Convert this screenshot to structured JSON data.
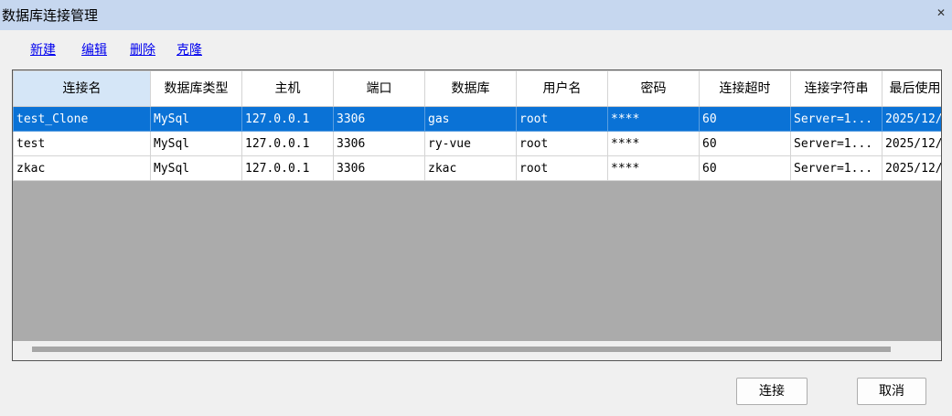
{
  "window": {
    "title": "数据库连接管理",
    "close_icon": "close-icon"
  },
  "menu": {
    "new": "新建",
    "edit": "编辑",
    "delete": "删除",
    "clone": "克隆"
  },
  "grid": {
    "columns": [
      "连接名",
      "数据库类型",
      "主机",
      "端口",
      "数据库",
      "用户名",
      "密码",
      "连接超时",
      "连接字符串",
      "最后使用时间"
    ],
    "rows": [
      [
        "test_Clone",
        "MySql",
        "127.0.0.1",
        "3306",
        "gas",
        "root",
        "****",
        "60",
        "Server=1...",
        "2025/12/"
      ],
      [
        "test",
        "MySql",
        "127.0.0.1",
        "3306",
        "ry-vue",
        "root",
        "****",
        "60",
        "Server=1...",
        "2025/12/"
      ],
      [
        "zkac",
        "MySql",
        "127.0.0.1",
        "3306",
        "zkac",
        "root",
        "****",
        "60",
        "Server=1...",
        "2025/12/"
      ]
    ]
  },
  "buttons": {
    "connect": "连接",
    "cancel": "取消"
  },
  "colors": {
    "titlebar": "#c6d7ef",
    "selection": "#0a72d6",
    "grid_empty": "#ababab",
    "link": "#0000ee"
  }
}
